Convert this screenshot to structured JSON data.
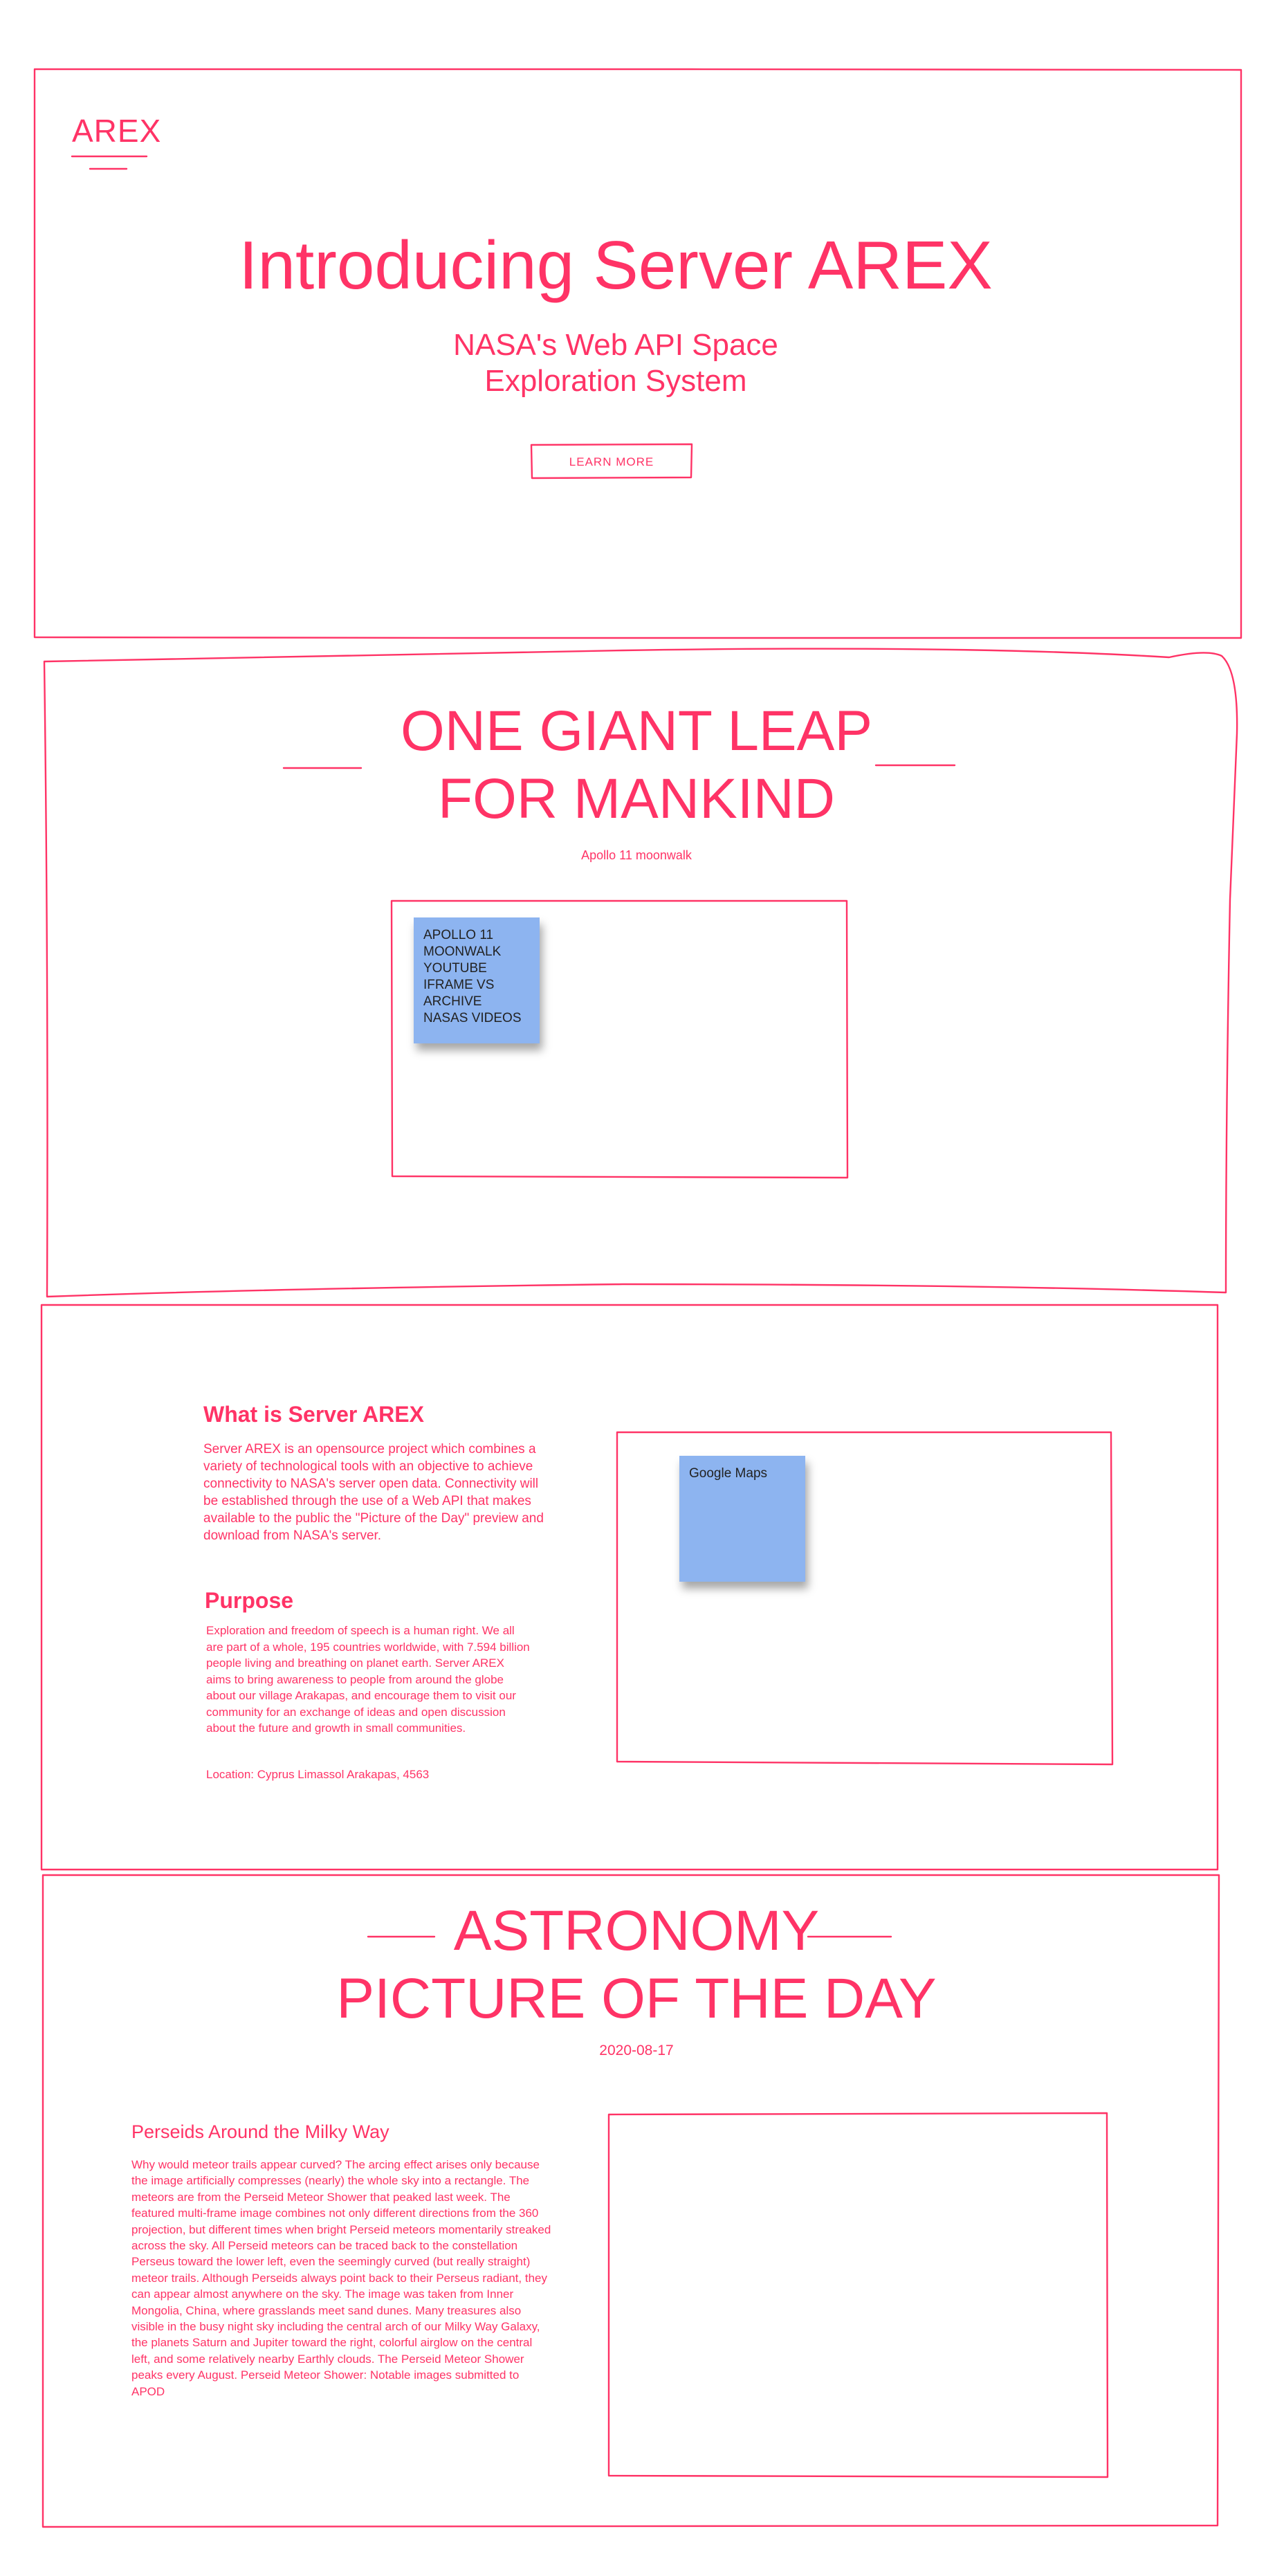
{
  "brand": {
    "logo": "AREX",
    "accent_color": "#ff3366",
    "sticky_color": "#8db4f0"
  },
  "hero": {
    "title": "Introducing Server AREX",
    "subtitle_line1": "NASA's Web API Space",
    "subtitle_line2": "Exploration System",
    "button_label": "LEARN MORE"
  },
  "moonwalk": {
    "title_line1": "ONE GIANT LEAP",
    "title_line2": "FOR MANKIND",
    "caption": "Apollo 11 moonwalk",
    "placeholder_note": "APOLLO 11 MOONWALK YOUTUBE IFRAME VS ARCHIVE NASAS VIDEOS"
  },
  "about": {
    "what_title": "What is Server AREX",
    "what_body": "Server AREX is an opensource project which combines a variety of technological tools with an objective to achieve connectivity to NASA's server open data. Connectivity will be established through the use of a Web API that makes available to the public the \"Picture of the Day\" preview and download from NASA's server.",
    "purpose_title": "Purpose",
    "purpose_body": "Exploration and freedom of speech is a human right. We all are part of a whole, 195 countries worldwide, with 7.594 billion people living and breathing on planet earth. Server AREX aims to bring awareness to people from around the globe about our village Arakapas, and encourage them to visit our community for an exchange of ideas and open discussion about the future and growth in small communities.",
    "location": "Location: Cyprus Limassol Arakapas, 4563",
    "map_note": "Google Maps"
  },
  "apod": {
    "title_line1": "ASTRONOMY",
    "title_line2": "PICTURE OF THE DAY",
    "date": "2020-08-17",
    "article_title": "Perseids Around the Milky Way",
    "article_body": "Why would meteor trails appear curved? The arcing effect arises only because the image artificially compresses (nearly) the whole sky into a rectangle. The meteors are from the Perseid Meteor Shower that peaked last week. The featured multi-frame image combines not only different directions from the 360 projection, but different times when bright Perseid meteors momentarily streaked across the sky. All Perseid meteors can be traced back to the constellation Perseus toward the lower left, even the seemingly curved (but really straight) meteor trails. Although Perseids always point back to their Perseus radiant, they can appear almost anywhere on the sky. The image was taken from Inner Mongolia, China, where grasslands meet sand dunes. Many treasures also visible in the busy night sky including the central arch of our Milky Way Galaxy, the planets Saturn and Jupiter toward the right, colorful airglow on the central left, and some relatively nearby Earthly clouds. The Perseid Meteor Shower peaks every August. Perseid Meteor Shower: Notable images submitted to APOD"
  }
}
